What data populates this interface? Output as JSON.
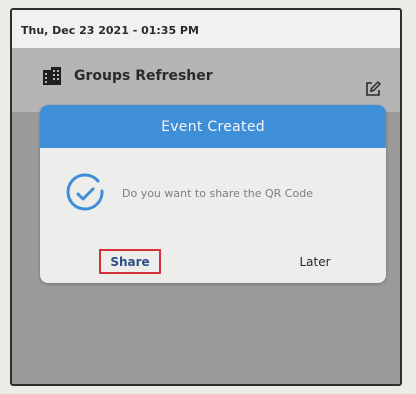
{
  "status": {
    "datetime": "Thu, Dec 23 2021 - 01:35 PM"
  },
  "event": {
    "name": "Groups Refresher",
    "icon": "building-icon",
    "edit_icon": "edit-icon"
  },
  "dialog": {
    "title": "Event Created",
    "icon": "check-circle-icon",
    "message": "Do you want to share the QR Code",
    "share_label": "Share",
    "later_label": "Later"
  },
  "colors": {
    "header": "#3f8ed8",
    "highlight": "#d4313a",
    "share_text": "#2d4d86",
    "overlay": "#9a9a99"
  }
}
